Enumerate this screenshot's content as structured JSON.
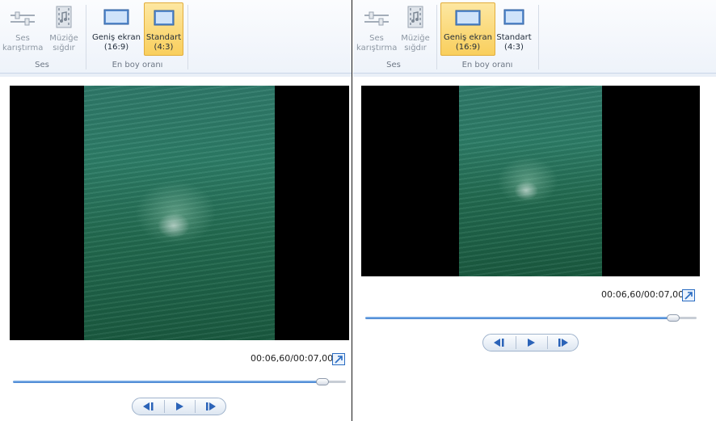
{
  "left": {
    "ribbon": {
      "audio_mix_label_1": "Ses",
      "audio_mix_label_2": "karıştırma",
      "fit_music_label_1": "Müziğe",
      "fit_music_label_2": "sığdır",
      "audio_group": "Ses",
      "widescreen_label_1": "Geniş ekran",
      "widescreen_label_2": "(16:9)",
      "standard_label_1": "Standart",
      "standard_label_2": "(4:3)",
      "aspect_group": "En boy oranı",
      "selected": "standard"
    },
    "player": {
      "timecode": "00:06,60/00:07,00",
      "progress": 0.94
    }
  },
  "right": {
    "ribbon": {
      "audio_mix_label_1": "Ses",
      "audio_mix_label_2": "karıştırma",
      "fit_music_label_1": "Müziğe",
      "fit_music_label_2": "sığdır",
      "audio_group": "Ses",
      "widescreen_label_1": "Geniş ekran",
      "widescreen_label_2": "(16:9)",
      "standard_label_1": "Standart",
      "standard_label_2": "(4:3)",
      "aspect_group": "En boy oranı",
      "selected": "widescreen"
    },
    "player": {
      "timecode": "00:06,60/00:07,00",
      "progress": 0.94
    }
  },
  "icons": {
    "audio_mix": "mixer-sliders-icon",
    "fit_music": "film-music-icon",
    "widescreen": "monitor-icon",
    "standard": "monitor-icon",
    "popout": "popout-arrow-icon",
    "prev_frame": "previous-frame-icon",
    "play": "play-icon",
    "next_frame": "next-frame-icon"
  },
  "colors": {
    "accent": "#3f7fd0",
    "active_button": "#f9cf5d",
    "ribbon_bg": "#eef3fa"
  }
}
